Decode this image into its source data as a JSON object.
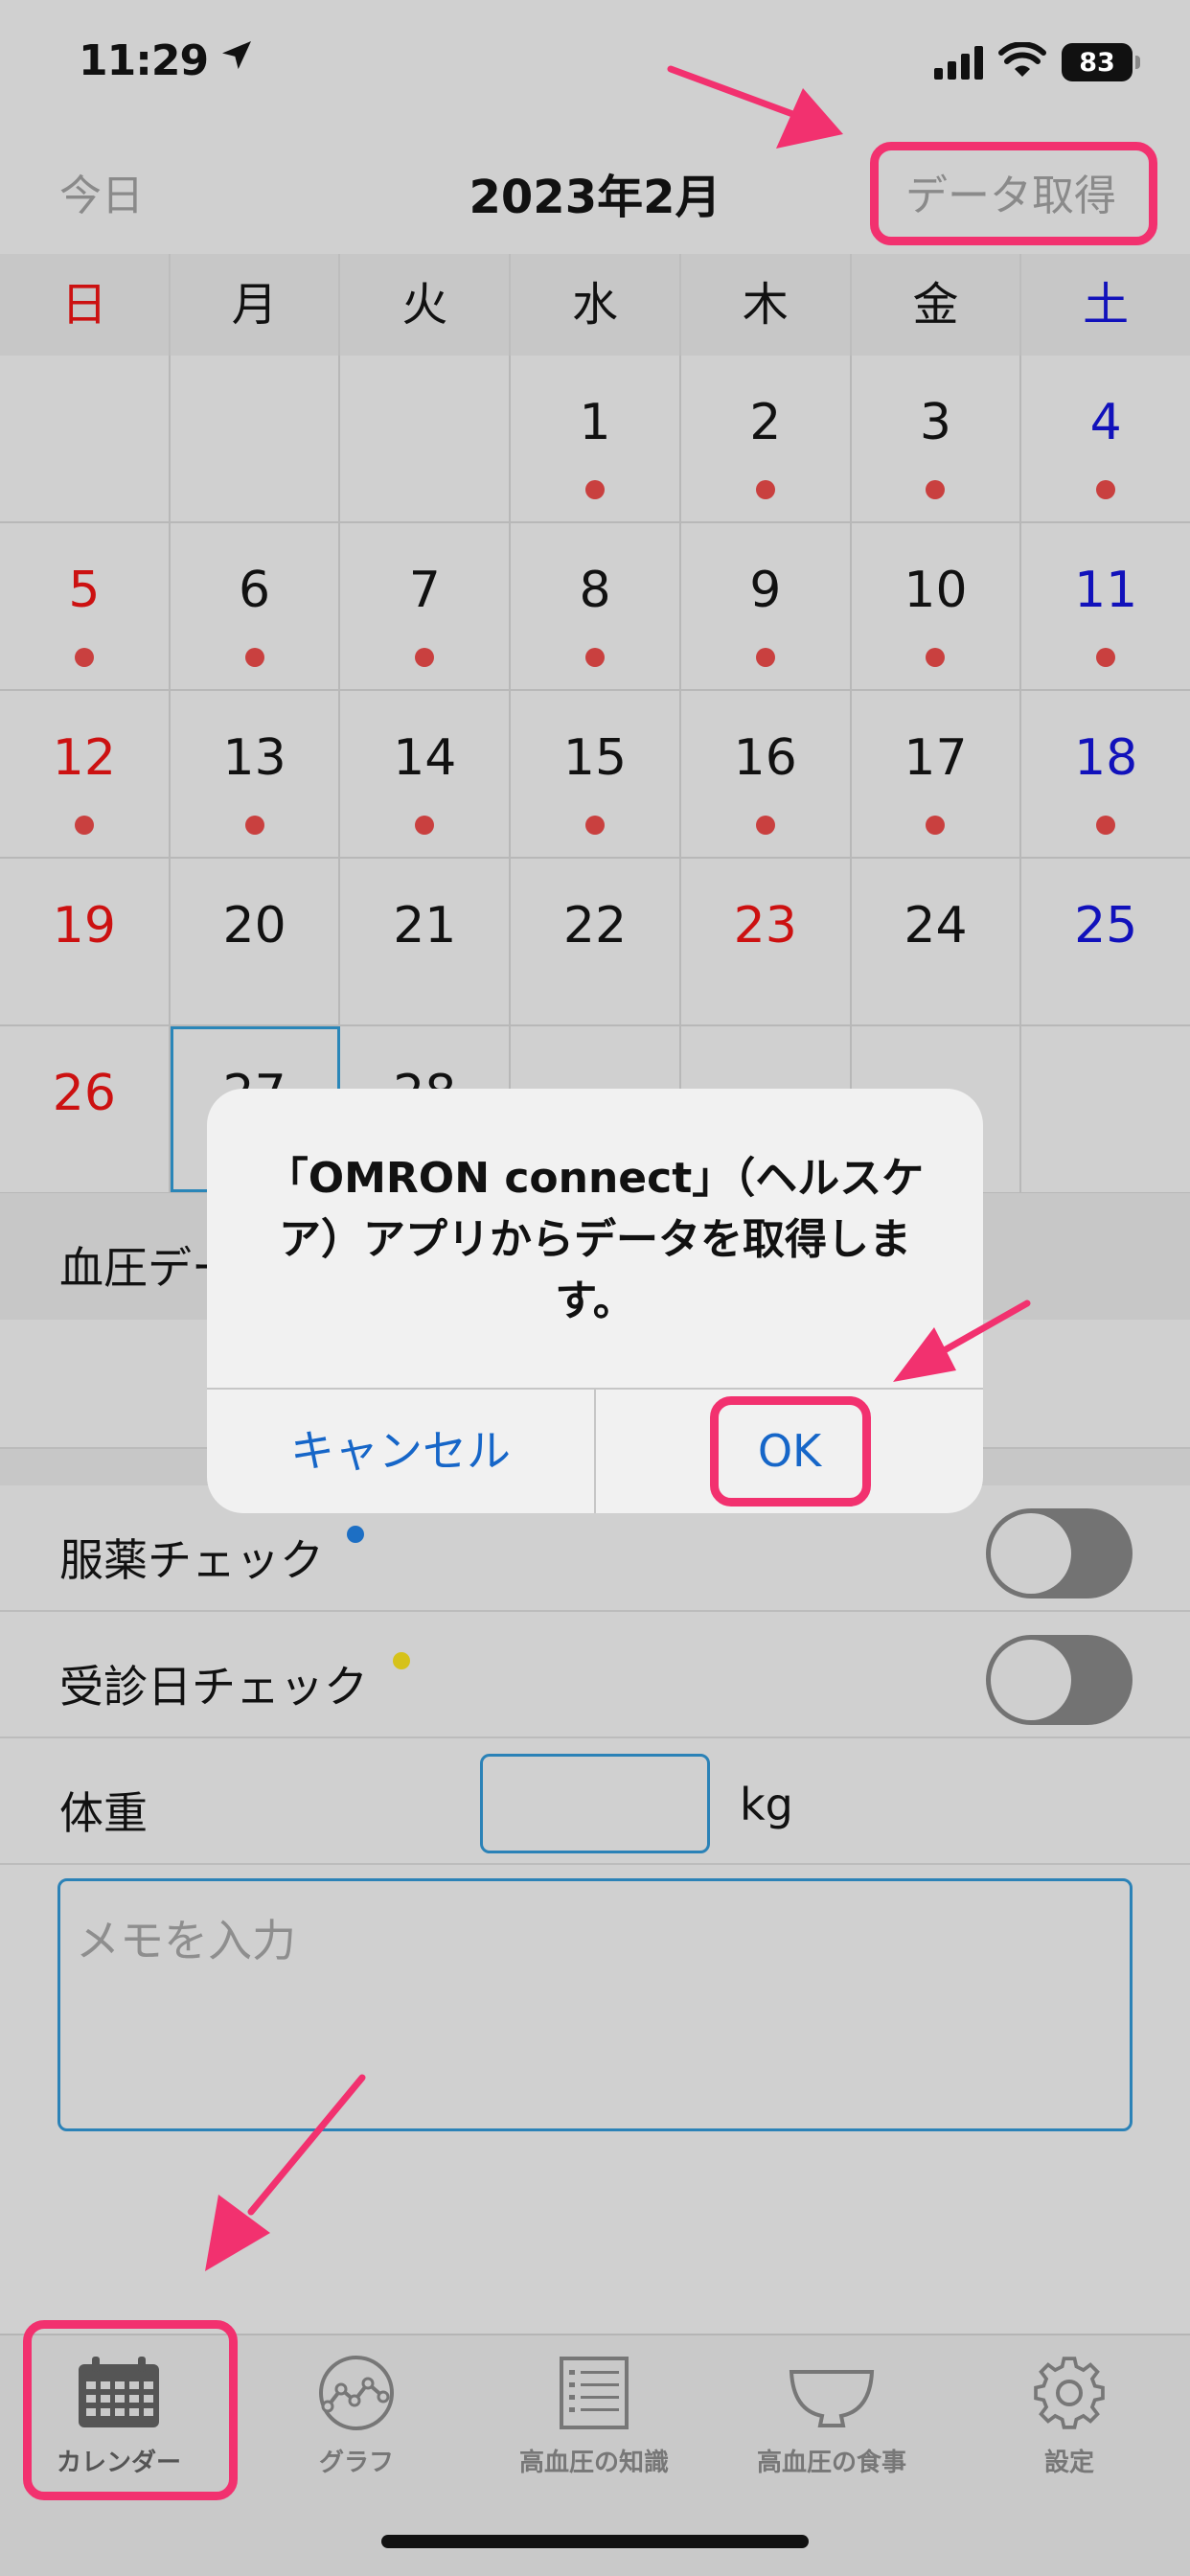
{
  "status_bar": {
    "time": "11:29",
    "battery": "83"
  },
  "nav": {
    "today": "今日",
    "title": "2023年2月",
    "fetch": "データ取得"
  },
  "calendar": {
    "weekdays": [
      "日",
      "月",
      "火",
      "水",
      "木",
      "金",
      "土"
    ],
    "weeks": [
      [
        {
          "day": "",
          "dot": false
        },
        {
          "day": "",
          "dot": false
        },
        {
          "day": "",
          "dot": false
        },
        {
          "day": "1",
          "dot": true
        },
        {
          "day": "2",
          "dot": true
        },
        {
          "day": "3",
          "dot": true
        },
        {
          "day": "4",
          "dot": true
        }
      ],
      [
        {
          "day": "5",
          "dot": true
        },
        {
          "day": "6",
          "dot": true
        },
        {
          "day": "7",
          "dot": true
        },
        {
          "day": "8",
          "dot": true
        },
        {
          "day": "9",
          "dot": true
        },
        {
          "day": "10",
          "dot": true
        },
        {
          "day": "11",
          "dot": true
        }
      ],
      [
        {
          "day": "12",
          "dot": true
        },
        {
          "day": "13",
          "dot": true
        },
        {
          "day": "14",
          "dot": true
        },
        {
          "day": "15",
          "dot": true
        },
        {
          "day": "16",
          "dot": true
        },
        {
          "day": "17",
          "dot": true
        },
        {
          "day": "18",
          "dot": true
        }
      ],
      [
        {
          "day": "19",
          "dot": false
        },
        {
          "day": "20",
          "dot": false
        },
        {
          "day": "21",
          "dot": false
        },
        {
          "day": "22",
          "dot": false
        },
        {
          "day": "23",
          "dot": false,
          "holiday": true
        },
        {
          "day": "24",
          "dot": false
        },
        {
          "day": "25",
          "dot": false
        }
      ],
      [
        {
          "day": "26",
          "dot": false
        },
        {
          "day": "27",
          "dot": false,
          "selected": true
        },
        {
          "day": "28",
          "dot": false
        },
        {
          "day": "",
          "dot": false
        },
        {
          "day": "",
          "dot": false
        },
        {
          "day": "",
          "dot": false
        },
        {
          "day": "",
          "dot": false
        }
      ]
    ]
  },
  "bp_section": {
    "header": "血圧デー"
  },
  "medication": {
    "label": "服薬チェック",
    "dot_color": "#1d6fc4",
    "on": false
  },
  "visit": {
    "label": "受診日チェック",
    "dot_color": "#d6c21a",
    "on": false
  },
  "weight": {
    "label": "体重",
    "unit": "kg",
    "value": ""
  },
  "memo": {
    "placeholder": "メモを入力"
  },
  "alert": {
    "message": "「OMRON connect」（ヘルスケア）アプリからデータを取得します。",
    "cancel": "キャンセル",
    "ok": "OK"
  },
  "tabs": [
    {
      "label": "カレンダー",
      "icon": "calendar-icon",
      "active": true
    },
    {
      "label": "グラフ",
      "icon": "graph-icon",
      "active": false
    },
    {
      "label": "高血圧の知識",
      "icon": "list-icon",
      "active": false
    },
    {
      "label": "高血圧の食事",
      "icon": "bowl-icon",
      "active": false
    },
    {
      "label": "設定",
      "icon": "gear-icon",
      "active": false
    }
  ],
  "colors": {
    "accent": "#2b82b7",
    "alert_button": "#1666c8",
    "highlight": "#f2316f",
    "sunday": "#cc1111",
    "saturday": "#1111bb"
  }
}
